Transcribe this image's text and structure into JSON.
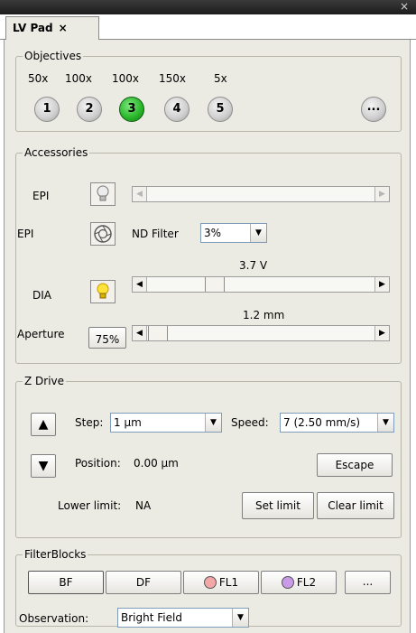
{
  "window": {
    "close_glyph": "×"
  },
  "tab": {
    "label": "LV Pad",
    "close_glyph": "×"
  },
  "objectives": {
    "legend": "Objectives",
    "items": [
      {
        "magnification": "50x",
        "number": "1",
        "active": false
      },
      {
        "magnification": "100x",
        "number": "2",
        "active": false
      },
      {
        "magnification": "100x",
        "number": "3",
        "active": true
      },
      {
        "magnification": "150x",
        "number": "4",
        "active": false
      },
      {
        "magnification": "5x",
        "number": "5",
        "active": false
      }
    ],
    "more_label": "...",
    "active_color": "#27b427"
  },
  "accessories": {
    "legend": "Accessories",
    "epi_lamp_label": "EPI",
    "epi_lamp_icon": "lightbulb-off-icon",
    "epi_shutter_label": "EPI",
    "epi_shutter_icon": "shutter-icon",
    "nd_filter_label": "ND Filter",
    "nd_filter_value": "3%",
    "dia_label": "DIA",
    "dia_icon": "lightbulb-on-icon",
    "dia_value_label": "3.7 V",
    "aperture_label": "Aperture",
    "aperture_button_label": "75%",
    "aperture_value_label": "1.2 mm"
  },
  "z_drive": {
    "legend": "Z Drive",
    "step_label": "Step:",
    "step_value": "1 µm",
    "speed_label": "Speed:",
    "speed_value": "7 (2.50 mm/s)",
    "position_label": "Position:",
    "position_value": "0.00 µm",
    "escape_label": "Escape",
    "lower_limit_label": "Lower limit:",
    "lower_limit_value": "NA",
    "set_limit_label": "Set limit",
    "clear_limit_label": "Clear limit"
  },
  "filter_blocks": {
    "legend": "FilterBlocks",
    "bf_label": "BF",
    "df_label": "DF",
    "fl1_label": "FL1",
    "fl1_color": "#f4a7a7",
    "fl2_label": "FL2",
    "fl2_color": "#c89ae8",
    "more_label": "...",
    "observation_label": "Observation:",
    "observation_value": "Bright Field"
  }
}
